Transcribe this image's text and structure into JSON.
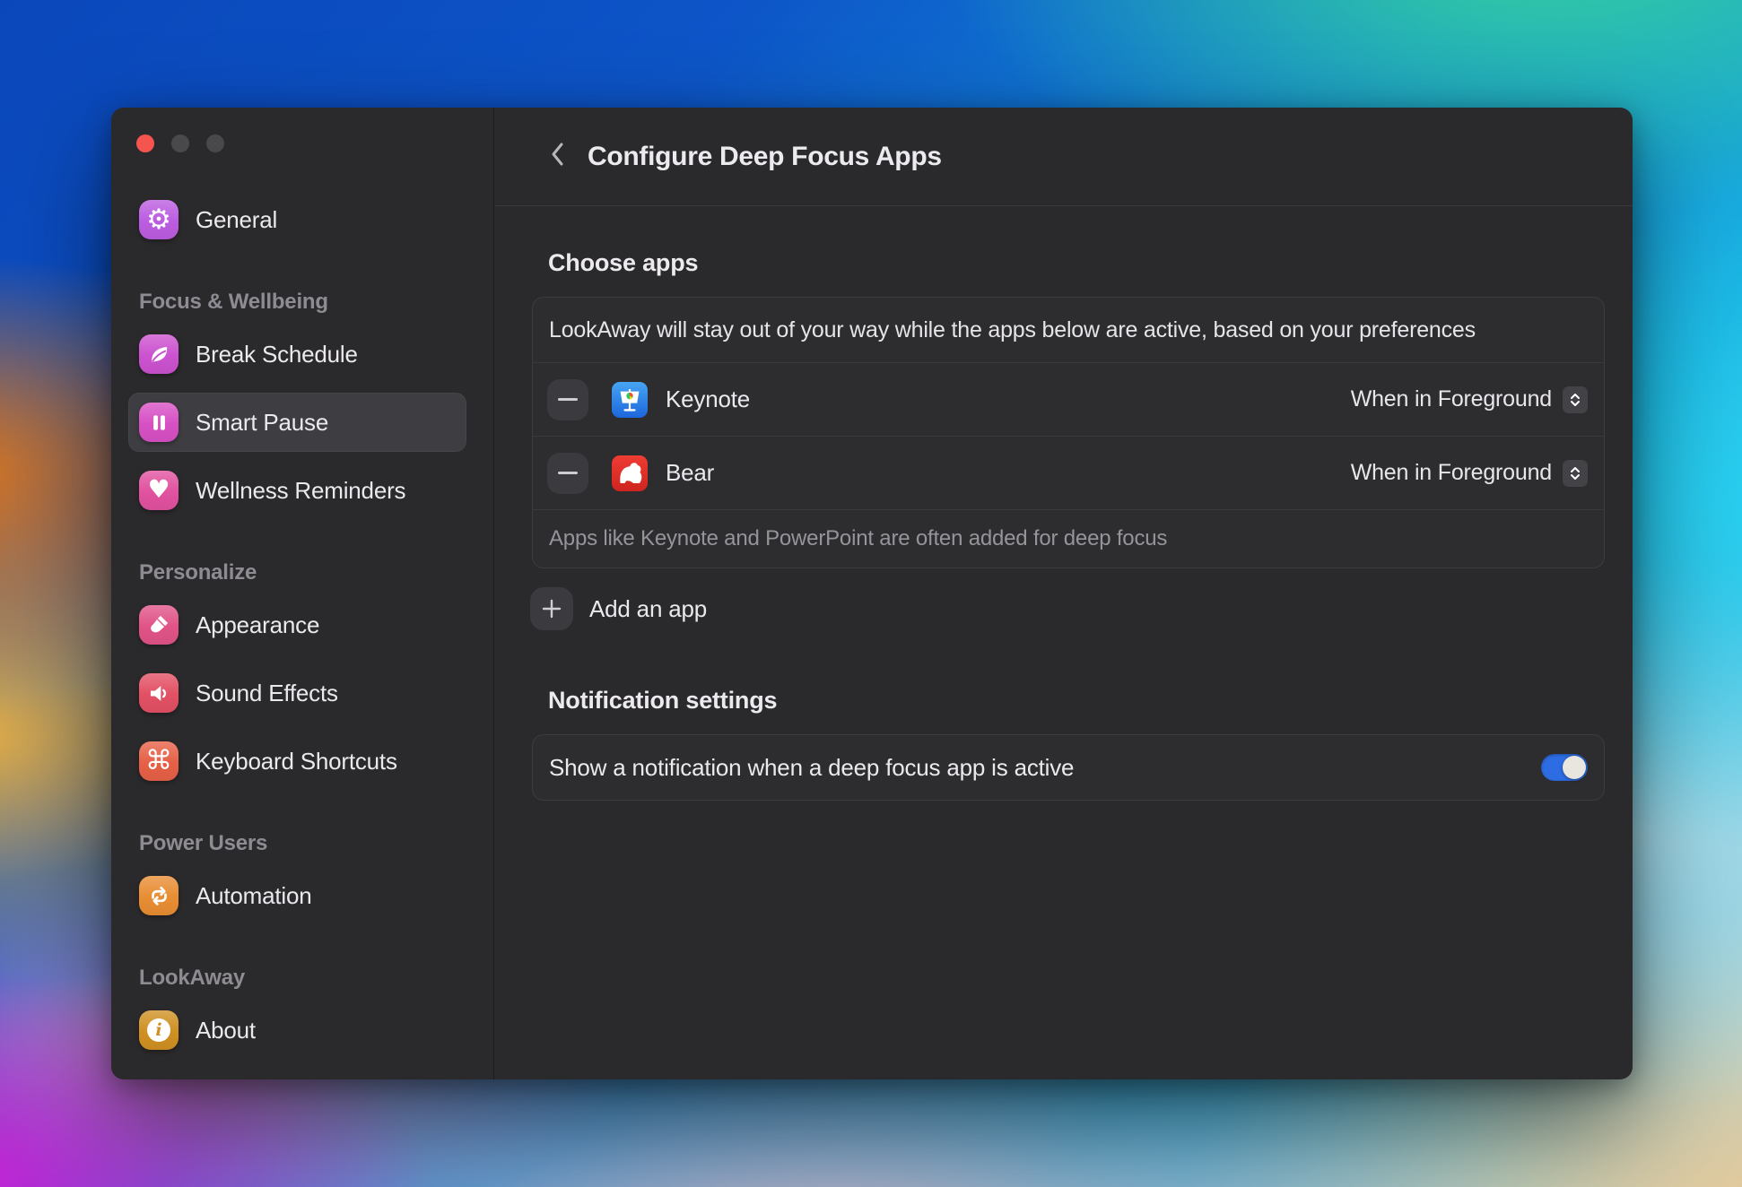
{
  "colors": {
    "toggle_on": "#2d6ce2",
    "traffic_close": "#f5554e",
    "traffic_inactive": "#49484b",
    "window_bg": "#2a292b"
  },
  "window": {
    "traffic_lights": [
      {
        "name": "close",
        "color": "#f5554e"
      },
      {
        "name": "minimize",
        "color": "#49484b"
      },
      {
        "name": "zoom",
        "color": "#49484b"
      }
    ],
    "sidebar": {
      "sections": [
        {
          "header": "",
          "items": [
            {
              "label": "General",
              "icon": "gear-icon",
              "color": "#bb5ce0",
              "selected": false
            }
          ]
        },
        {
          "header": "Focus & Wellbeing",
          "items": [
            {
              "label": "Break Schedule",
              "icon": "leaf-icon",
              "color": "#cb52cf",
              "selected": false
            },
            {
              "label": "Smart Pause",
              "icon": "pause-icon",
              "color": "#d750c4",
              "selected": true
            },
            {
              "label": "Wellness Reminders",
              "icon": "heart-icon",
              "color": "#e1519f",
              "selected": false
            }
          ]
        },
        {
          "header": "Personalize",
          "items": [
            {
              "label": "Appearance",
              "icon": "paintbrush-icon",
              "color": "#e05387",
              "selected": false
            },
            {
              "label": "Sound Effects",
              "icon": "speaker-icon",
              "color": "#e25064",
              "selected": false
            },
            {
              "label": "Keyboard Shortcuts",
              "icon": "command-icon",
              "color": "#e66047",
              "selected": false
            }
          ]
        },
        {
          "header": "Power Users",
          "items": [
            {
              "label": "Automation",
              "icon": "repeat-icon",
              "color": "#e88d33",
              "selected": false
            }
          ]
        },
        {
          "header": "LookAway",
          "items": [
            {
              "label": "About",
              "icon": "info-icon",
              "color": "#cf9022",
              "selected": false
            }
          ]
        }
      ]
    },
    "header": {
      "title": "Configure Deep Focus Apps"
    },
    "choose_apps": {
      "heading": "Choose apps",
      "description": "LookAway will stay out of your way while the apps below are active, based on your preferences",
      "apps": [
        {
          "name": "Keynote",
          "icon": "keynote-app-icon",
          "mode": "When in Foreground"
        },
        {
          "name": "Bear",
          "icon": "bear-app-icon",
          "mode": "When in Foreground"
        }
      ],
      "footnote": "Apps like Keynote and PowerPoint are often added for deep focus",
      "add_label": "Add an app"
    },
    "notification_settings": {
      "heading": "Notification settings",
      "toggle_label": "Show a notification when a deep focus app is active",
      "toggle_on": true
    }
  }
}
